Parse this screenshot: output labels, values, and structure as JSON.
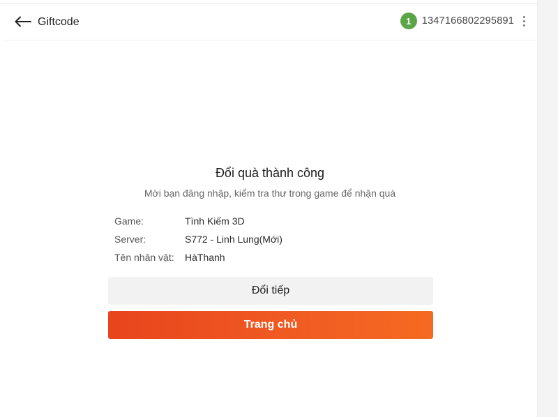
{
  "header": {
    "title": "Giftcode",
    "back_icon": "arrow-left-icon",
    "badge_count": "1",
    "user_id": "1347166802295891",
    "more_icon": "more-vertical-icon"
  },
  "result": {
    "title": "Đổi quà thành công",
    "subtitle": "Mời bạn đăng nhập, kiểm tra thư trong game để nhận quà"
  },
  "info": [
    {
      "label": "Game:",
      "value": "Tình Kiếm 3D"
    },
    {
      "label": "Server:",
      "value": "S772 - Linh Lung(Mới)"
    },
    {
      "label": "Tên nhân vật:",
      "value": "HàThanh"
    }
  ],
  "actions": {
    "continue_label": "Đổi tiếp",
    "home_label": "Trang chủ"
  },
  "colors": {
    "badge": "#5aa545",
    "primary_start": "#e8441d",
    "primary_end": "#f56a22"
  }
}
